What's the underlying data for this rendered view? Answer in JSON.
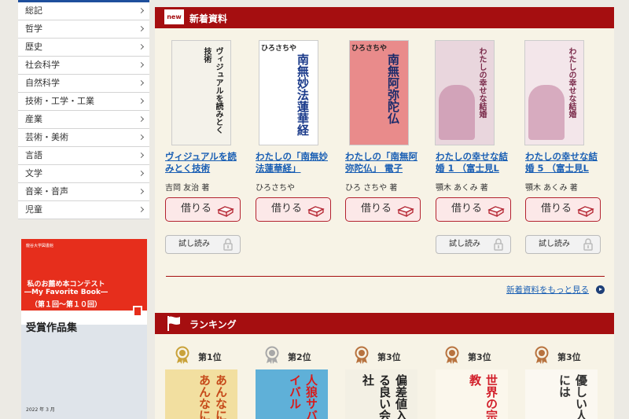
{
  "sidebar": {
    "categories": [
      "総記",
      "哲学",
      "歴史",
      "社会科学",
      "自然科学",
      "技術・工学・工業",
      "産業",
      "芸術・美術",
      "言語",
      "文学",
      "音楽・音声",
      "児童"
    ]
  },
  "banner": {
    "library": "龍谷大学図書館",
    "line1": "私のお薦め本コンテスト",
    "line2": "―My Favorite Book―",
    "line3": "（第１回～第１０回）",
    "title": "受賞作品集",
    "date": "2022 年 3 月"
  },
  "new_section": {
    "badge": "new",
    "title": "新着資料",
    "borrow_label": "借りる",
    "try_label": "試し読み",
    "more_label": "新着資料をもっと見る",
    "books": [
      {
        "title": "ヴィジュアルを読みとく技術",
        "author": "吉岡 友治 著",
        "cover_text": "ヴィジュアルを読みとく技術",
        "has_try": true
      },
      {
        "title": "わたしの「南無妙法蓮華経」",
        "author": "ひろさちや",
        "cover_text": "南無妙法蓮華経",
        "cover_author": "ひろさちや",
        "has_try": false
      },
      {
        "title": "わたしの「南無阿弥陀仏」 電子",
        "author": "ひろ さちや 著",
        "cover_text": "南無阿弥陀仏",
        "cover_author": "ひろさちや",
        "has_try": false
      },
      {
        "title": "わたしの幸せな結婚 1 （富士見L",
        "author": "顎木 あくみ 著",
        "cover_text": "わたしの幸せな結婚",
        "has_try": true
      },
      {
        "title": "わたしの幸せな結婚 5 （富士見L",
        "author": "顎木 あくみ 著",
        "cover_text": "わたしの幸せな結婚",
        "has_try": true
      }
    ]
  },
  "ranking_section": {
    "title": "ランキング",
    "items": [
      {
        "rank": "第1位",
        "medal": "gold",
        "cover_text": "あんなにあんなに"
      },
      {
        "rank": "第2位",
        "medal": "silver",
        "cover_text": "人狼サバイバル"
      },
      {
        "rank": "第3位",
        "medal": "bronze",
        "cover_text": "偏差値入る良い会社"
      },
      {
        "rank": "第3位",
        "medal": "bronze",
        "cover_text": "世界の宗教"
      },
      {
        "rank": "第3位",
        "medal": "bronze",
        "cover_text": "優しい人には"
      }
    ]
  },
  "colors": {
    "accent": "#a50e10",
    "link": "#1a5fb4",
    "sidebar_border": "#1e4f9c",
    "gold": "#c9a23a",
    "silver": "#a8a8a8",
    "bronze": "#b8733f"
  }
}
